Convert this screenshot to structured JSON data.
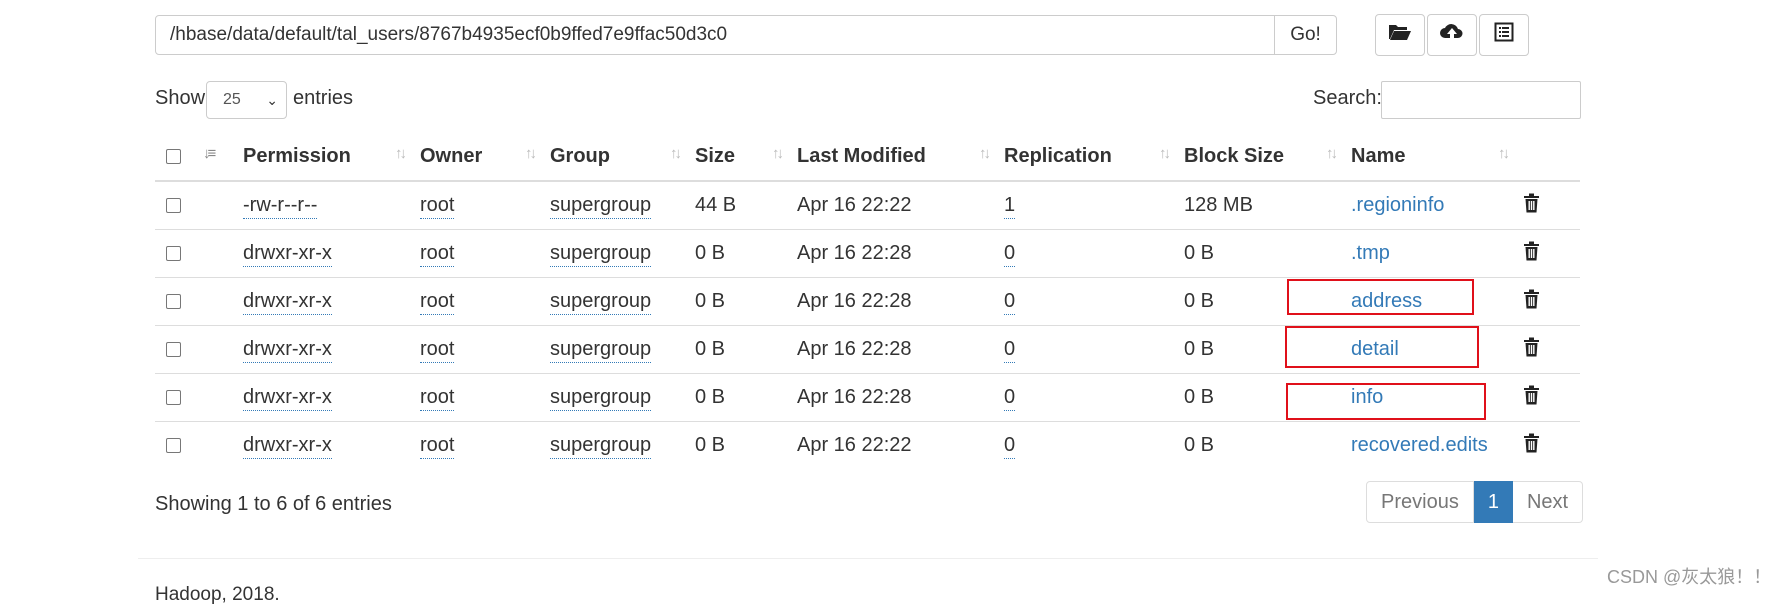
{
  "path_bar": {
    "path_value": "/hbase/data/default/tal_users/8767b4935ecf0b9ffed7e9ffac50d3c0",
    "go_label": "Go!"
  },
  "toolbar": {
    "icons": [
      "folder-open-icon",
      "cloud-upload-icon",
      "list-icon"
    ]
  },
  "controls": {
    "show_label": "Show",
    "page_length": "25",
    "entries_label": "entries",
    "search_label": "Search:",
    "search_value": ""
  },
  "table": {
    "headers": {
      "permission": "Permission",
      "owner": "Owner",
      "group": "Group",
      "size": "Size",
      "last_modified": "Last Modified",
      "replication": "Replication",
      "block_size": "Block Size",
      "name": "Name"
    },
    "rows": [
      {
        "permission": "-rw-r--r--",
        "owner": "root",
        "group": "supergroup",
        "size": "44 B",
        "last_modified": "Apr 16 22:22",
        "replication": "1",
        "block_size": "128 MB",
        "name": ".regioninfo"
      },
      {
        "permission": "drwxr-xr-x",
        "owner": "root",
        "group": "supergroup",
        "size": "0 B",
        "last_modified": "Apr 16 22:28",
        "replication": "0",
        "block_size": "0 B",
        "name": ".tmp"
      },
      {
        "permission": "drwxr-xr-x",
        "owner": "root",
        "group": "supergroup",
        "size": "0 B",
        "last_modified": "Apr 16 22:28",
        "replication": "0",
        "block_size": "0 B",
        "name": "address"
      },
      {
        "permission": "drwxr-xr-x",
        "owner": "root",
        "group": "supergroup",
        "size": "0 B",
        "last_modified": "Apr 16 22:28",
        "replication": "0",
        "block_size": "0 B",
        "name": "detail"
      },
      {
        "permission": "drwxr-xr-x",
        "owner": "root",
        "group": "supergroup",
        "size": "0 B",
        "last_modified": "Apr 16 22:28",
        "replication": "0",
        "block_size": "0 B",
        "name": "info"
      },
      {
        "permission": "drwxr-xr-x",
        "owner": "root",
        "group": "supergroup",
        "size": "0 B",
        "last_modified": "Apr 16 22:22",
        "replication": "0",
        "block_size": "0 B",
        "name": "recovered.edits"
      }
    ]
  },
  "footer": {
    "info": "Showing 1 to 6 of 6 entries",
    "pagination": {
      "previous": "Previous",
      "current": "1",
      "next": "Next"
    },
    "copyright": "Hadoop, 2018."
  },
  "watermark": "CSDN @灰太狼！！",
  "colors": {
    "link": "#337ab7",
    "highlight_box": "#e0101a",
    "border": "#dddddd"
  }
}
